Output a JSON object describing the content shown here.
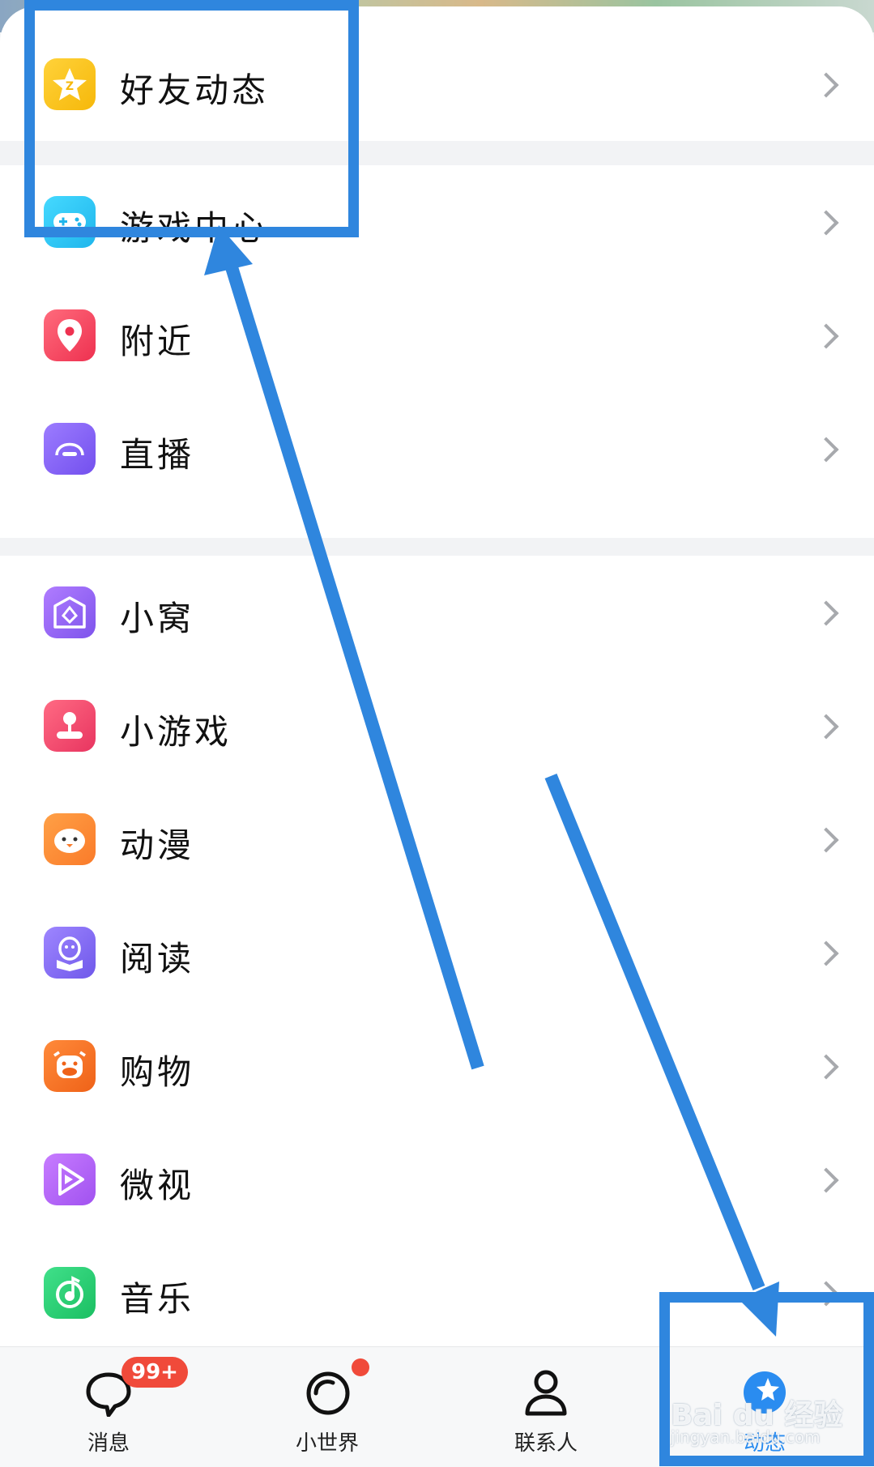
{
  "menu": {
    "groups": [
      {
        "items": [
          {
            "label": "好友动态",
            "icon": "qzone-star-icon",
            "color": "#f9c414"
          }
        ]
      },
      {
        "items": [
          {
            "label": "游戏中心",
            "icon": "gamepad-icon",
            "color": "#2fc7f0"
          },
          {
            "label": "附近",
            "icon": "location-pin-icon",
            "color": "#f2495c"
          },
          {
            "label": "直播",
            "icon": "live-dome-icon",
            "color": "#8a6cf2"
          }
        ]
      },
      {
        "items": [
          {
            "label": "小窝",
            "icon": "home-diamond-icon",
            "color": "#9a66f0"
          },
          {
            "label": "小游戏",
            "icon": "joystick-icon",
            "color": "#f24d6a"
          },
          {
            "label": "动漫",
            "icon": "chick-face-icon",
            "color": "#fd8a3a"
          },
          {
            "label": "阅读",
            "icon": "penguin-book-icon",
            "color": "#8a70f0"
          },
          {
            "label": "购物",
            "icon": "cow-face-icon",
            "color": "#f67a2c"
          },
          {
            "label": "微视",
            "icon": "play-triangle-icon",
            "color": "#b36cf2"
          },
          {
            "label": "音乐",
            "icon": "music-note-icon",
            "color": "#2fd178"
          }
        ]
      }
    ]
  },
  "tabbar": {
    "tabs": [
      {
        "label": "消息",
        "icon": "chat-bubble-icon",
        "badge": "99+"
      },
      {
        "label": "小世界",
        "icon": "ring-planet-icon"
      },
      {
        "label": "联系人",
        "icon": "person-icon"
      },
      {
        "label": "动态",
        "icon": "star-globe-icon",
        "active": true
      }
    ]
  },
  "watermark": {
    "brand": "Bai du 经验",
    "url": "jingyan.baidu.com"
  },
  "colors": {
    "annotation": "#2f86de",
    "active_tab": "#2a8cf0",
    "badge": "#f04a3a"
  }
}
